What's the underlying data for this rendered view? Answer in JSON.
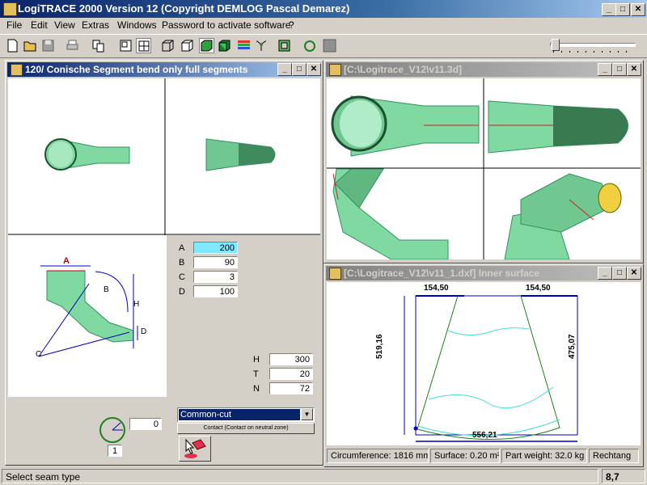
{
  "app": {
    "title": "LogiTRACE 2000  Version 12  (Copyright DEMLOG Pascal Demarez)"
  },
  "menu": [
    "File",
    "Edit",
    "View",
    "Extras",
    "Windows",
    "Password to activate software",
    "?"
  ],
  "window_controls": {
    "minimize": "_",
    "maximize": "□",
    "close": "✕"
  },
  "left_window": {
    "title": "120/ Conische Segment bend only full segments",
    "diagram_labels": {
      "A": "A",
      "B": "B",
      "C": "C",
      "H": "H",
      "D": "D"
    },
    "params": [
      {
        "label": "A",
        "value": "200"
      },
      {
        "label": "B",
        "value": "90"
      },
      {
        "label": "C",
        "value": "3"
      },
      {
        "label": "D",
        "value": "100"
      }
    ],
    "params2": [
      {
        "label": "H",
        "value": "300"
      },
      {
        "label": "T",
        "value": "20"
      },
      {
        "label": "N",
        "value": "72"
      }
    ],
    "seam_angle": "0",
    "seam_count": "1",
    "cut_select": "Common-cut",
    "contact_button": "Contact (Contact on neutral zone)"
  },
  "view3d_window": {
    "title": "[C:\\Logitrace_V12\\v11.3d]"
  },
  "dxf_window": {
    "title": "[C:\\Logitrace_V12\\v11_1.dxf]  Inner surface",
    "dims": {
      "top_left": "154,50",
      "top_right": "154,50",
      "left": "519,16",
      "right": "475,07",
      "bottom": "556,21"
    },
    "info": {
      "circumference": "Circumference: 1816 mm",
      "surface": "Surface: 0.20 m²",
      "weight": "Part weight: 32.0 kg",
      "shape": "Rechtang"
    }
  },
  "statusbar": {
    "message": "Select seam type",
    "value": "8,7"
  },
  "colors": {
    "active_title": "#0a246a",
    "part_green": "#7fd9a0",
    "dim_blue": "#0000c0",
    "highlight_field": "#80e8ff"
  }
}
